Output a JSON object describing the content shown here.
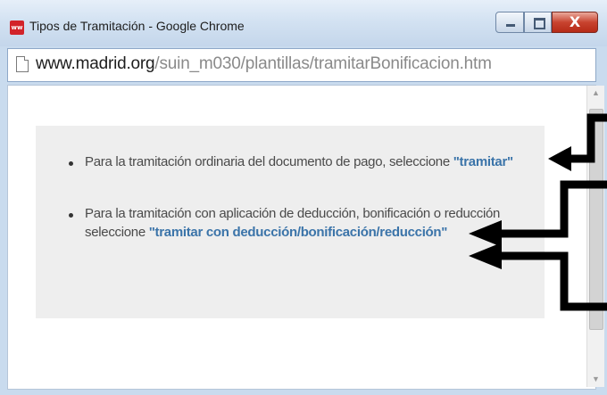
{
  "window": {
    "title": "Tipos de Tramitación - Google Chrome",
    "app_icon_text": "ww",
    "controls": {
      "minimize": "",
      "maximize": "",
      "close": "X"
    }
  },
  "address": {
    "host": "www.madrid.org",
    "path": "/suin_m030/plantillas/tramitarBonificacion.htm"
  },
  "content": {
    "item1": {
      "text": "Para la tramitación ordinaria del documento de pago, seleccione ",
      "keyword": "\"tramitar\""
    },
    "item2": {
      "line1": "Para la tramitación con aplicación de deducción, bonificación o reducción",
      "line2_prefix": "seleccione ",
      "keyword": "\"tramitar con deducción/bonificación/reducción\""
    }
  },
  "scrollbar": {
    "up_icon": "▲",
    "down_icon": "▼"
  },
  "colors": {
    "panel": "#eeeeee",
    "keyword": "#3b74a9",
    "close_button": "#c8432f"
  }
}
